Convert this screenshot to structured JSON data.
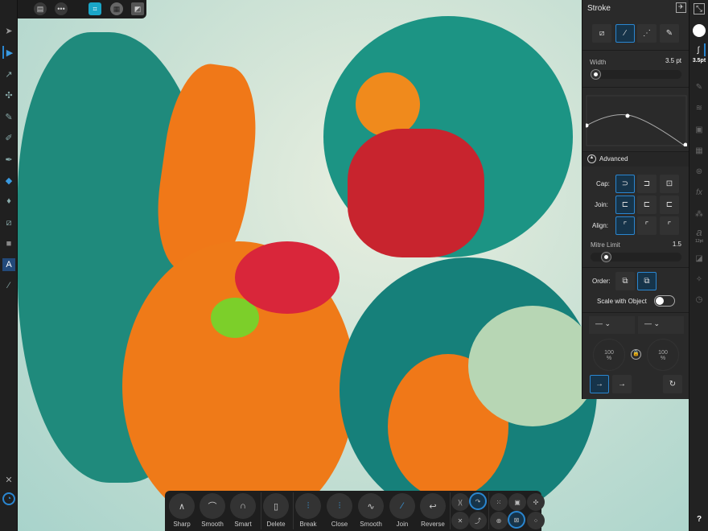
{
  "topbar": {
    "icons": [
      "back-icon",
      "document-icon",
      "more-icon",
      "snapping-icon",
      "grid-icon",
      "view-mode-icon"
    ],
    "more_label": "•••"
  },
  "left_tools": [
    "move-tool",
    "node-tool",
    "corner-tool",
    "point-transform-tool",
    "pencil-tool",
    "vector-brush-tool",
    "pen-tool",
    "fill-tool",
    "transparency-tool",
    "crop-tool",
    "shape-tool",
    "text-tool",
    "color-picker-tool"
  ],
  "stroke_panel": {
    "title": "Stroke",
    "width_label": "Width",
    "width_value": "3.5 pt",
    "width_fraction": 0.05,
    "advanced_label": "Advanced",
    "cap_label": "Cap:",
    "join_label": "Join:",
    "align_label": "Align:",
    "mitre_label": "Mitre Limit",
    "mitre_value": "1.5",
    "mitre_fraction": 0.15,
    "order_label": "Order:",
    "scale_label": "Scale with Object",
    "scale_on": false,
    "start_pct": "100",
    "end_pct": "100",
    "pct_unit": "%"
  },
  "right_sidebar": {
    "stroke_size": "3.5pt",
    "text_size": "12pt",
    "help": "?"
  },
  "bottom_toolbar": {
    "buttons": [
      "Sharp",
      "Smooth",
      "Smart",
      "Delete",
      "Break",
      "Close",
      "Smooth",
      "Join",
      "Reverse"
    ]
  },
  "colors": {
    "accent": "#2a86d0",
    "panel": "#2a2a2a"
  }
}
